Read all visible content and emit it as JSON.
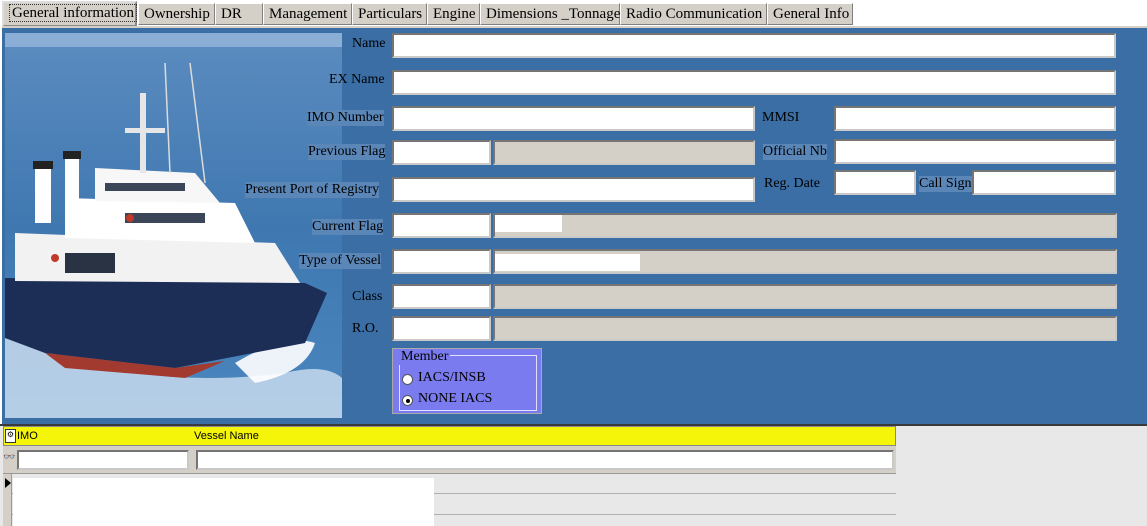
{
  "tabs": [
    {
      "label": "General information",
      "active": true
    },
    {
      "label": "Ownership"
    },
    {
      "label": "DR"
    },
    {
      "label": "Management"
    },
    {
      "label": "Particulars"
    },
    {
      "label": "Engine"
    },
    {
      "label": "Dimensions _Tonnage"
    },
    {
      "label": "Radio Communication"
    },
    {
      "label": "General Info"
    }
  ],
  "form": {
    "name_label": "Name",
    "ex_name_label": "EX Name",
    "imo_label": "IMO Number",
    "mmsi_label": "MMSI",
    "previous_flag_label": "Previous Flag",
    "official_nb_label": "Official Nb",
    "port_label": "Present Port of Registry",
    "reg_date_label": "Reg. Date",
    "call_sign_label": "Call Sign",
    "current_flag_label": "Current Flag",
    "type_label": "Type of Vessel",
    "class_label": "Class",
    "ro_label": "R.O."
  },
  "member": {
    "legend": "Member",
    "options": [
      {
        "label": "IACS/INSB",
        "checked": false
      },
      {
        "label": "NONE IACS",
        "checked": true
      }
    ]
  },
  "grid": {
    "columns": [
      "IMO",
      "Vessel Name"
    ]
  },
  "colors": {
    "panel": "#3a6ea5",
    "grid_header": "#f5f50a",
    "member_box": "#7b7bf0"
  }
}
